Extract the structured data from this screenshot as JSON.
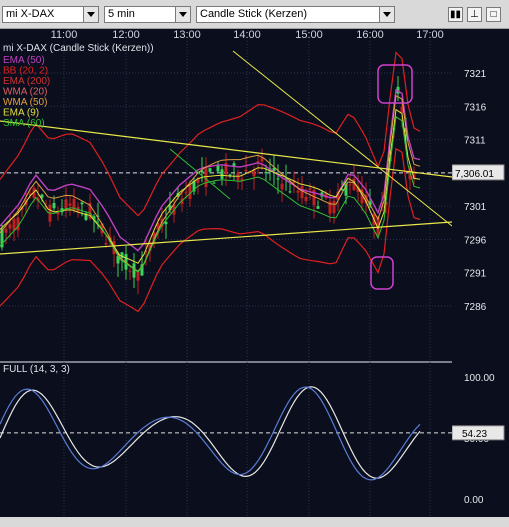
{
  "toolbar": {
    "symbol": "mi X-DAX",
    "interval": "5 min",
    "chart_type": "Candle Stick (Kerzen)"
  },
  "time_labels": [
    "11:00",
    "12:00",
    "13:00",
    "14:00",
    "15:00",
    "16:00",
    "17:00"
  ],
  "price_labels": [
    "7321",
    "7316",
    "7311",
    "7301",
    "7296",
    "7291",
    "7286"
  ],
  "current_price": "7,306.01",
  "legend": {
    "title": "mi X-DAX (Candle Stick (Kerzen))",
    "items": [
      {
        "label": "EMA (50)",
        "color": "#c040c0"
      },
      {
        "label": "BB (20, 2)",
        "color": "#e02020"
      },
      {
        "label": "EMA (200)",
        "color": "#d03030"
      },
      {
        "label": "WMA (20)",
        "color": "#e06060"
      },
      {
        "label": "WMA (50)",
        "color": "#e0a040"
      },
      {
        "label": "EMA (9)",
        "color": "#e0e040"
      },
      {
        "label": "SMA (60)",
        "color": "#30c030"
      }
    ]
  },
  "oscillator": {
    "title": "FULL (14, 3, 3)",
    "labels": [
      "100.00",
      "50.00",
      "0.00"
    ],
    "current_value": "54.23"
  },
  "colors": {
    "background": "#0b0e1c",
    "up_candle": "#3bd35a",
    "down_candle": "#c02020",
    "trendline": "#e8e84a",
    "highlight": "#d040d0"
  },
  "chart_data": {
    "type": "line",
    "x": [
      "11:00",
      "12:00",
      "13:00",
      "14:00",
      "15:00",
      "16:00",
      "17:00"
    ],
    "series": [
      {
        "name": "mi X-DAX (Candle Stick (Kerzen))",
        "values": [
          7303,
          7297,
          7301,
          7306,
          7304,
          7304,
          7306
        ]
      }
    ],
    "ylim": [
      7283,
      7325
    ],
    "oscillator": {
      "title": "FULL (14, 3, 3)",
      "ylim": [
        0,
        100
      ],
      "last": 54.23
    }
  }
}
